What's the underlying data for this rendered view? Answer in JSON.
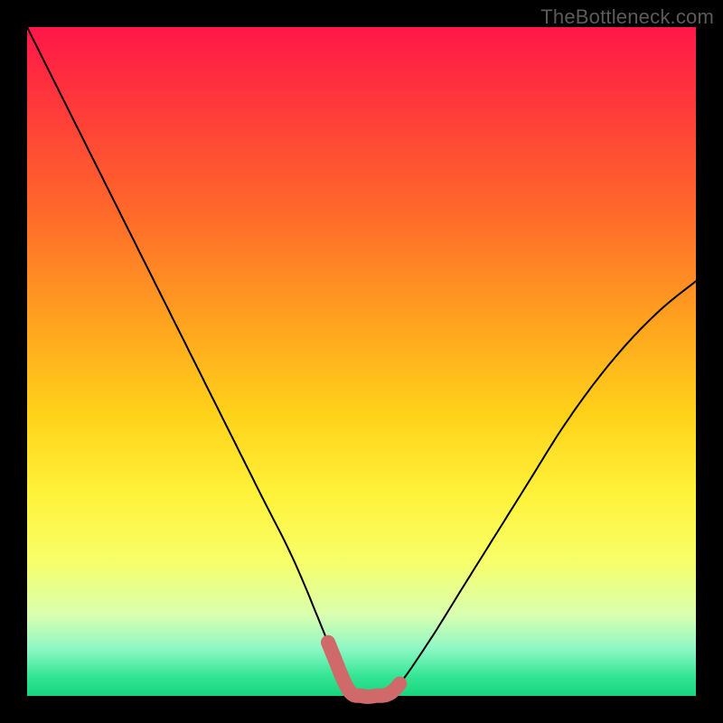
{
  "watermark": "TheBottleneck.com",
  "chart_data": {
    "type": "line",
    "title": "",
    "xlabel": "",
    "ylabel": "",
    "xlim": [
      0,
      100
    ],
    "ylim": [
      0,
      100
    ],
    "series": [
      {
        "name": "bottleneck-curve",
        "x": [
          0,
          5,
          10,
          15,
          20,
          25,
          30,
          35,
          40,
          45,
          48,
          50,
          52,
          55,
          60,
          65,
          70,
          75,
          80,
          85,
          90,
          95,
          100
        ],
        "y": [
          100,
          90,
          80,
          70,
          60,
          50,
          40,
          30,
          20,
          8,
          1,
          0,
          0,
          1,
          8,
          16,
          24,
          32,
          40,
          47,
          53,
          58,
          62
        ]
      }
    ],
    "highlight_segment": {
      "name": "minimum-region",
      "x_start": 45,
      "x_end": 56,
      "color": "#d06a6a"
    },
    "background_gradient": {
      "direction": "top-to-bottom",
      "stops": [
        {
          "pos": 0,
          "color": "#ff1748"
        },
        {
          "pos": 50,
          "color": "#ffd21a"
        },
        {
          "pos": 80,
          "color": "#f7ff6a"
        },
        {
          "pos": 100,
          "color": "#18d47b"
        }
      ]
    }
  }
}
